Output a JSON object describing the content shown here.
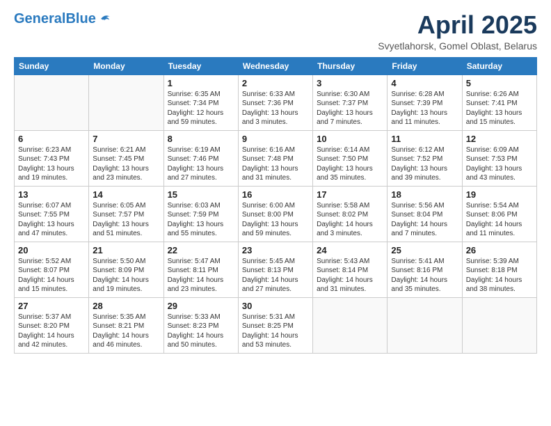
{
  "header": {
    "logo_line1": "General",
    "logo_line2": "Blue",
    "title": "April 2025",
    "subtitle": "Svyetlahorsk, Gomel Oblast, Belarus"
  },
  "weekdays": [
    "Sunday",
    "Monday",
    "Tuesday",
    "Wednesday",
    "Thursday",
    "Friday",
    "Saturday"
  ],
  "weeks": [
    [
      {
        "day": "",
        "info": ""
      },
      {
        "day": "",
        "info": ""
      },
      {
        "day": "1",
        "info": "Sunrise: 6:35 AM\nSunset: 7:34 PM\nDaylight: 12 hours and 59 minutes."
      },
      {
        "day": "2",
        "info": "Sunrise: 6:33 AM\nSunset: 7:36 PM\nDaylight: 13 hours and 3 minutes."
      },
      {
        "day": "3",
        "info": "Sunrise: 6:30 AM\nSunset: 7:37 PM\nDaylight: 13 hours and 7 minutes."
      },
      {
        "day": "4",
        "info": "Sunrise: 6:28 AM\nSunset: 7:39 PM\nDaylight: 13 hours and 11 minutes."
      },
      {
        "day": "5",
        "info": "Sunrise: 6:26 AM\nSunset: 7:41 PM\nDaylight: 13 hours and 15 minutes."
      }
    ],
    [
      {
        "day": "6",
        "info": "Sunrise: 6:23 AM\nSunset: 7:43 PM\nDaylight: 13 hours and 19 minutes."
      },
      {
        "day": "7",
        "info": "Sunrise: 6:21 AM\nSunset: 7:45 PM\nDaylight: 13 hours and 23 minutes."
      },
      {
        "day": "8",
        "info": "Sunrise: 6:19 AM\nSunset: 7:46 PM\nDaylight: 13 hours and 27 minutes."
      },
      {
        "day": "9",
        "info": "Sunrise: 6:16 AM\nSunset: 7:48 PM\nDaylight: 13 hours and 31 minutes."
      },
      {
        "day": "10",
        "info": "Sunrise: 6:14 AM\nSunset: 7:50 PM\nDaylight: 13 hours and 35 minutes."
      },
      {
        "day": "11",
        "info": "Sunrise: 6:12 AM\nSunset: 7:52 PM\nDaylight: 13 hours and 39 minutes."
      },
      {
        "day": "12",
        "info": "Sunrise: 6:09 AM\nSunset: 7:53 PM\nDaylight: 13 hours and 43 minutes."
      }
    ],
    [
      {
        "day": "13",
        "info": "Sunrise: 6:07 AM\nSunset: 7:55 PM\nDaylight: 13 hours and 47 minutes."
      },
      {
        "day": "14",
        "info": "Sunrise: 6:05 AM\nSunset: 7:57 PM\nDaylight: 13 hours and 51 minutes."
      },
      {
        "day": "15",
        "info": "Sunrise: 6:03 AM\nSunset: 7:59 PM\nDaylight: 13 hours and 55 minutes."
      },
      {
        "day": "16",
        "info": "Sunrise: 6:00 AM\nSunset: 8:00 PM\nDaylight: 13 hours and 59 minutes."
      },
      {
        "day": "17",
        "info": "Sunrise: 5:58 AM\nSunset: 8:02 PM\nDaylight: 14 hours and 3 minutes."
      },
      {
        "day": "18",
        "info": "Sunrise: 5:56 AM\nSunset: 8:04 PM\nDaylight: 14 hours and 7 minutes."
      },
      {
        "day": "19",
        "info": "Sunrise: 5:54 AM\nSunset: 8:06 PM\nDaylight: 14 hours and 11 minutes."
      }
    ],
    [
      {
        "day": "20",
        "info": "Sunrise: 5:52 AM\nSunset: 8:07 PM\nDaylight: 14 hours and 15 minutes."
      },
      {
        "day": "21",
        "info": "Sunrise: 5:50 AM\nSunset: 8:09 PM\nDaylight: 14 hours and 19 minutes."
      },
      {
        "day": "22",
        "info": "Sunrise: 5:47 AM\nSunset: 8:11 PM\nDaylight: 14 hours and 23 minutes."
      },
      {
        "day": "23",
        "info": "Sunrise: 5:45 AM\nSunset: 8:13 PM\nDaylight: 14 hours and 27 minutes."
      },
      {
        "day": "24",
        "info": "Sunrise: 5:43 AM\nSunset: 8:14 PM\nDaylight: 14 hours and 31 minutes."
      },
      {
        "day": "25",
        "info": "Sunrise: 5:41 AM\nSunset: 8:16 PM\nDaylight: 14 hours and 35 minutes."
      },
      {
        "day": "26",
        "info": "Sunrise: 5:39 AM\nSunset: 8:18 PM\nDaylight: 14 hours and 38 minutes."
      }
    ],
    [
      {
        "day": "27",
        "info": "Sunrise: 5:37 AM\nSunset: 8:20 PM\nDaylight: 14 hours and 42 minutes."
      },
      {
        "day": "28",
        "info": "Sunrise: 5:35 AM\nSunset: 8:21 PM\nDaylight: 14 hours and 46 minutes."
      },
      {
        "day": "29",
        "info": "Sunrise: 5:33 AM\nSunset: 8:23 PM\nDaylight: 14 hours and 50 minutes."
      },
      {
        "day": "30",
        "info": "Sunrise: 5:31 AM\nSunset: 8:25 PM\nDaylight: 14 hours and 53 minutes."
      },
      {
        "day": "",
        "info": ""
      },
      {
        "day": "",
        "info": ""
      },
      {
        "day": "",
        "info": ""
      }
    ]
  ]
}
